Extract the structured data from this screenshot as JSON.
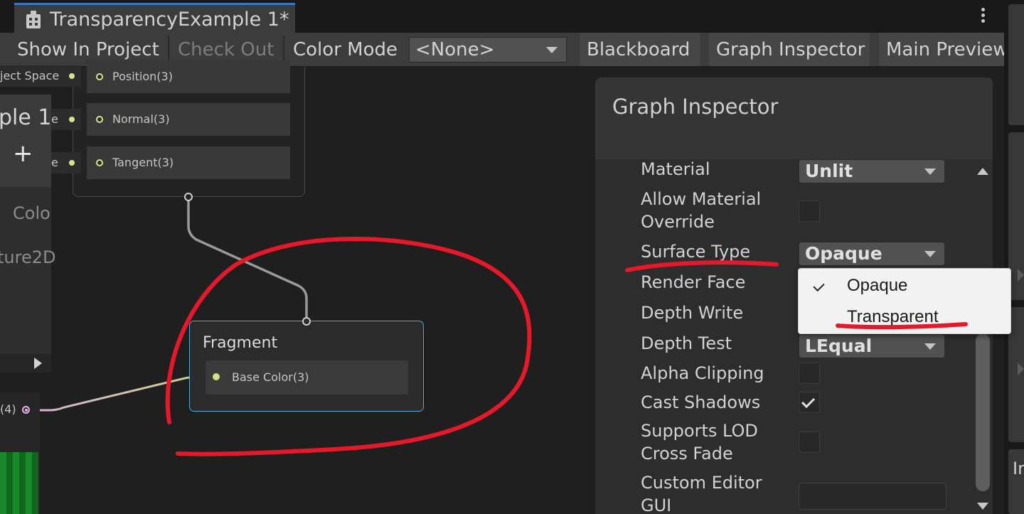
{
  "window": {
    "tab_title": "TransparencyExample 1*",
    "tab_icon": "shader-graph-icon",
    "menu_icon": "kebab-menu-icon"
  },
  "toolbar": {
    "show_in_project": "Show In Project",
    "check_out": "Check Out",
    "color_mode_label": "Color Mode",
    "color_mode_value": "<None>",
    "blackboard": "Blackboard",
    "graph_inspector": "Graph Inspector",
    "main_preview": "Main Preview"
  },
  "graph": {
    "left_node": {
      "title": "ple 1",
      "add_symbol": "+",
      "text_1": "Colo",
      "text_2": "ture2D",
      "output_label": "(4)"
    },
    "vertex_inputs": [
      {
        "chip": "ject Space",
        "slot": "Position(3)"
      },
      {
        "chip": "e",
        "slot": "Normal(3)"
      },
      {
        "chip": "e",
        "slot": "Tangent(3)"
      }
    ],
    "fragment": {
      "title": "Fragment",
      "slot": "Base Color(3)"
    }
  },
  "inspector": {
    "title": "Graph Inspector",
    "properties": [
      {
        "label": "Material",
        "type": "dropdown",
        "value": "Unlit"
      },
      {
        "label": "Allow Material\nOverride",
        "type": "checkbox",
        "checked": false
      },
      {
        "label": "Surface Type",
        "type": "dropdown",
        "value": "Opaque"
      },
      {
        "label": "Render Face",
        "type": "dropdown",
        "value": ""
      },
      {
        "label": "Depth Write",
        "type": "dropdown",
        "value": ""
      },
      {
        "label": "Depth Test",
        "type": "dropdown",
        "value": "LEqual"
      },
      {
        "label": "Alpha Clipping",
        "type": "checkbox",
        "checked": false
      },
      {
        "label": "Cast Shadows",
        "type": "checkbox",
        "checked": true
      },
      {
        "label": "Supports LOD\nCross Fade",
        "type": "checkbox",
        "checked": false
      },
      {
        "label": "Custom Editor\nGUI",
        "type": "text",
        "value": ""
      }
    ],
    "surface_type_menu": {
      "options": [
        "Opaque",
        "Transparent"
      ],
      "selected": "Opaque"
    }
  },
  "right_edge": {
    "partial_text": "In"
  },
  "colors": {
    "accent_tab": "#3a79bb",
    "fragment_border": "#50a9d9",
    "vector3_port": "#d6e58a",
    "vector4_port": "#e4b2e6",
    "annotation_red": "#e8182a"
  }
}
